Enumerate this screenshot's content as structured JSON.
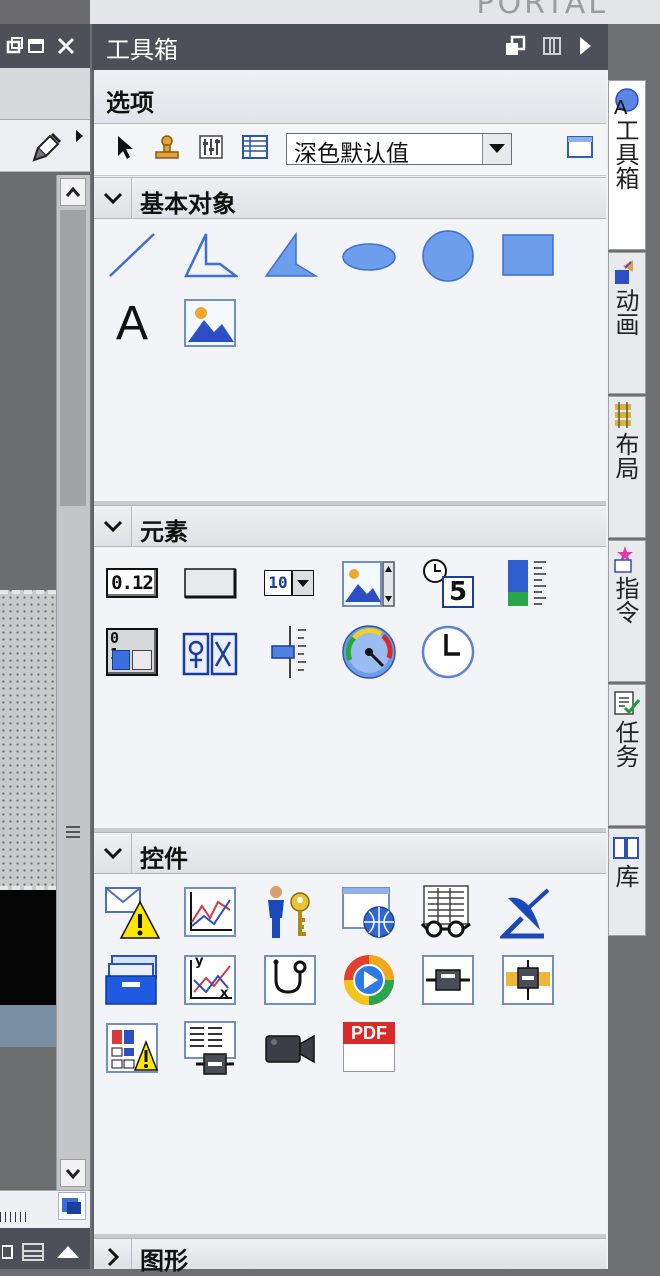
{
  "header": {
    "portal_text": "PORTAL"
  },
  "toolbox": {
    "title": "工具箱",
    "options_label": "选项",
    "style_select": {
      "value": "深色默认值"
    }
  },
  "sections": {
    "basic_objects": {
      "title": "基本对象",
      "state": "expanded",
      "items": [
        "line",
        "polyline",
        "polygon",
        "ellipse",
        "circle",
        "rectangle",
        "text-field",
        "graphic-view"
      ],
      "text_item_glyph": "A"
    },
    "elements": {
      "title": "元素",
      "state": "expanded",
      "items": [
        "io-field",
        "button",
        "symbolic-io-field",
        "graphic-io-field",
        "date-time-field",
        "bar",
        "switch",
        "symbol-library",
        "slider",
        "gauge",
        "clock"
      ],
      "io_field_text": "0.12",
      "symbolic_io_text": "10",
      "date_time_digit": "5",
      "switch_digits": "0 1"
    },
    "controls": {
      "title": "控件",
      "state": "expanded",
      "items": [
        "alarm-view",
        "trend-view",
        "user-view",
        "html-browser",
        "recipe-view",
        "sm-at-view",
        "media-player",
        "f-x-trend-view",
        "system-diagnostics-view",
        "media-player-2",
        "plc-code-viewer",
        "pdf-connector",
        "status-force",
        "recipe-table",
        "camera-control",
        "pdf-view"
      ],
      "pdf_label": "PDF",
      "fx_y": "y",
      "fx_x": "x"
    },
    "graphics": {
      "title": "图形",
      "state": "collapsed"
    }
  },
  "right_tabs": [
    {
      "label": "工具箱",
      "active": true
    },
    {
      "label": "动画",
      "active": false
    },
    {
      "label": "布局",
      "active": false
    },
    {
      "label": "指令",
      "active": false
    },
    {
      "label": "任务",
      "active": false
    },
    {
      "label": "库",
      "active": false
    }
  ],
  "colors": {
    "title_bar": "#4d5058",
    "panel_bg": "#f0f1f4",
    "shape_fill": "#6d9eeb",
    "shape_stroke": "#3d6fd6",
    "warning_yellow": "#ffe600"
  }
}
